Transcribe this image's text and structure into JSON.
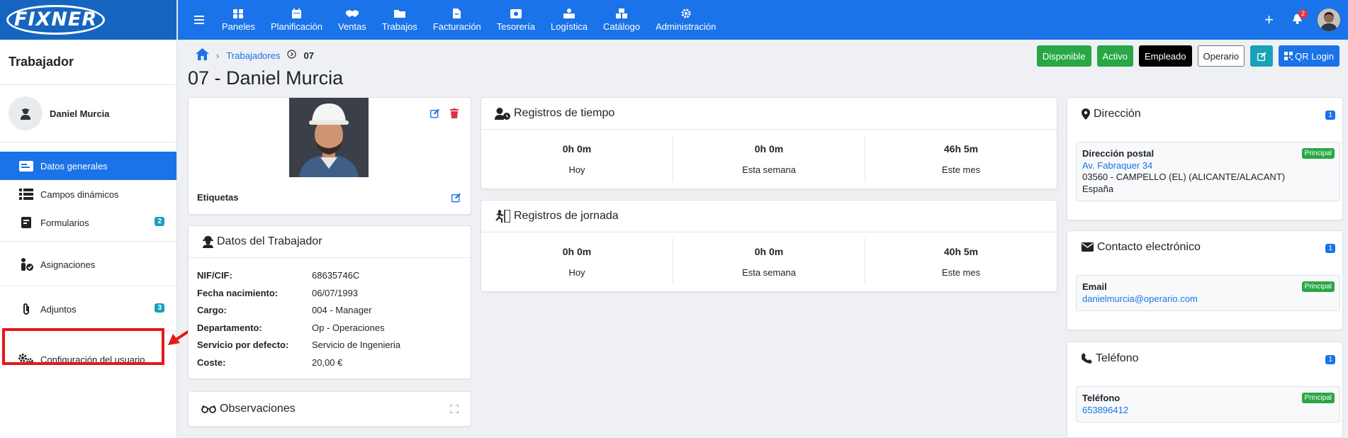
{
  "brand": {
    "name": "FIXNER"
  },
  "sidebar": {
    "title": "Trabajador",
    "user_name": "Daniel Murcia",
    "items": [
      {
        "label": "Datos generales",
        "icon": "id-card-icon",
        "active": true
      },
      {
        "label": "Campos dinámicos",
        "icon": "list-icon"
      },
      {
        "label": "Formularios",
        "icon": "form-icon",
        "badge": "2"
      },
      {
        "label": "Asignaciones",
        "icon": "person-check-icon"
      },
      {
        "label": "Adjuntos",
        "icon": "paperclip-icon",
        "badge": "3"
      },
      {
        "label": "Configuración del usuario",
        "icon": "gears-icon"
      }
    ]
  },
  "nav": {
    "items": [
      {
        "label": "Paneles",
        "icon": "dashboard-icon"
      },
      {
        "label": "Planificación",
        "icon": "calendar-icon"
      },
      {
        "label": "Ventas",
        "icon": "handshake-icon"
      },
      {
        "label": "Trabajos",
        "icon": "folder-icon"
      },
      {
        "label": "Facturación",
        "icon": "invoice-icon"
      },
      {
        "label": "Tesorería",
        "icon": "cash-register-icon"
      },
      {
        "label": "Logística",
        "icon": "dolly-icon"
      },
      {
        "label": "Catálogo",
        "icon": "boxes-icon"
      },
      {
        "label": "Administración",
        "icon": "gear-icon"
      }
    ],
    "notifications_count": "2"
  },
  "breadcrumb": {
    "parent": "Trabajadores",
    "current": "07"
  },
  "page_title": "07 - Daniel Murcia",
  "header_buttons": {
    "disponible": "Disponible",
    "activo": "Activo",
    "empleado": "Empleado",
    "operario": "Operario",
    "qr_login": "QR Login"
  },
  "colors": {
    "primary": "#1a73e8",
    "success": "#28a745",
    "danger": "#dc3545",
    "info": "#17a2b8"
  },
  "photo_card": {
    "labels_title": "Etiquetas"
  },
  "worker_data": {
    "title": "Datos del Trabajador",
    "rows": [
      {
        "key": "NIF/CIF:",
        "value": "68635746C"
      },
      {
        "key": "Fecha nacimiento:",
        "value": "06/07/1993"
      },
      {
        "key": "Cargo:",
        "value": "004 - Manager"
      },
      {
        "key": "Departamento:",
        "value": "Op - Operaciones"
      },
      {
        "key": "Servicio por defecto:",
        "value": "Servicio de Ingenieria"
      },
      {
        "key": "Coste:",
        "value": "20,00 €"
      }
    ]
  },
  "observations": {
    "title": "Observaciones"
  },
  "time_records": {
    "title": "Registros de tiempo",
    "stats": [
      {
        "value": "0h 0m",
        "label": "Hoy"
      },
      {
        "value": "0h 0m",
        "label": "Esta semana"
      },
      {
        "value": "46h 5m",
        "label": "Este mes"
      }
    ]
  },
  "workday_records": {
    "title": "Registros de jornada",
    "stats": [
      {
        "value": "0h 0m",
        "label": "Hoy"
      },
      {
        "value": "0h 0m",
        "label": "Esta semana"
      },
      {
        "value": "40h 5m",
        "label": "Este mes"
      }
    ]
  },
  "address": {
    "title": "Dirección",
    "count": "1",
    "box_title": "Dirección postal",
    "tag": "Principal",
    "street": "Av. Fabraquer 34",
    "city": "03560 - CAMPELLO (EL) (ALICANTE/ALACANT)",
    "country": "España"
  },
  "email_contact": {
    "title": "Contacto electrónico",
    "count": "1",
    "box_title": "Email",
    "tag": "Principal",
    "value": "danielmurcia@operario.com"
  },
  "phone": {
    "title": "Teléfono",
    "count": "1",
    "box_title": "Teléfono",
    "tag": "Principal",
    "value": "653896412"
  }
}
